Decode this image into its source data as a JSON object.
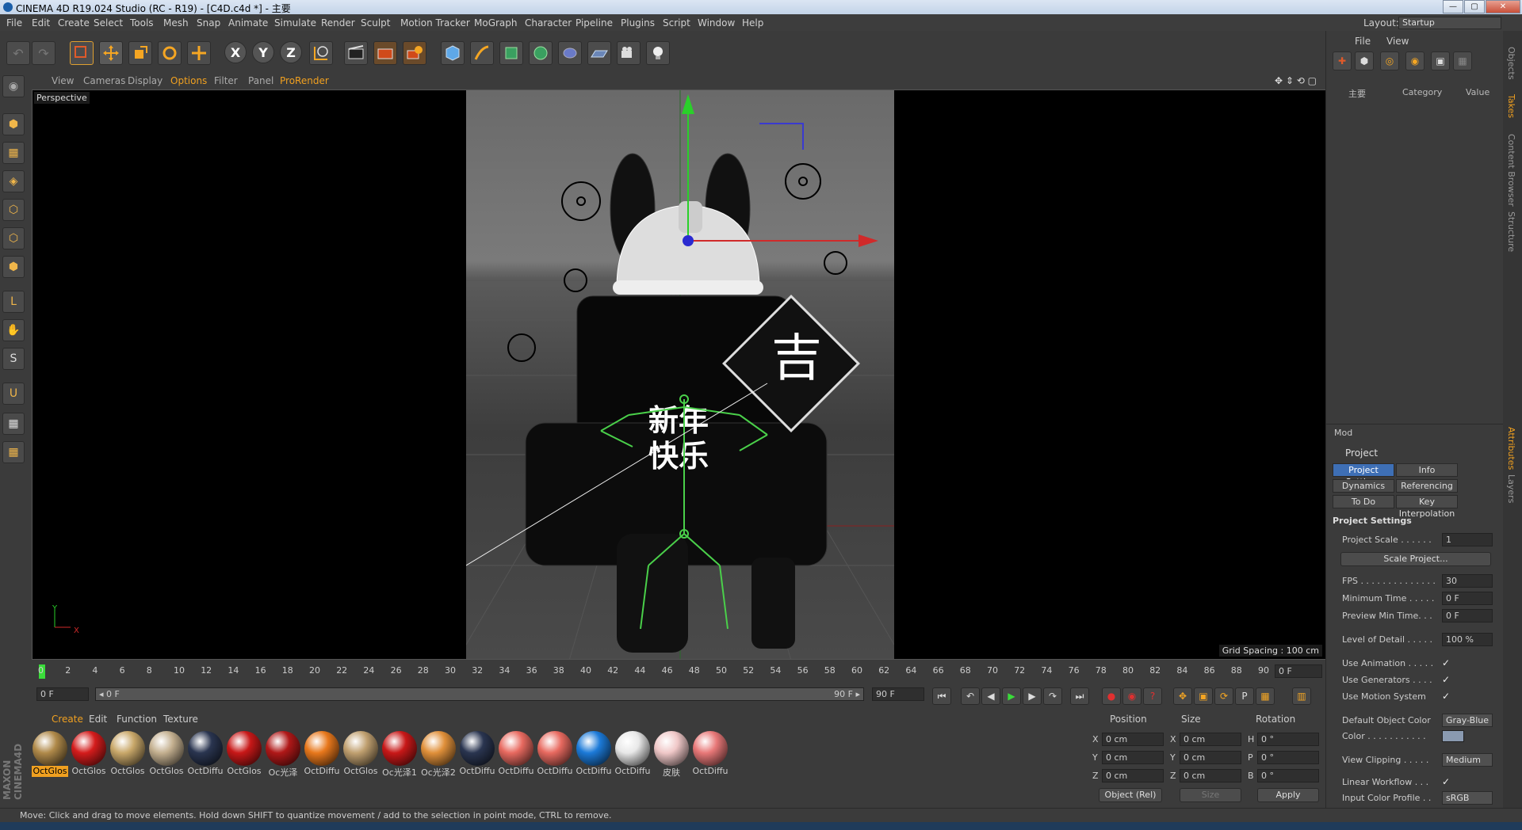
{
  "window": {
    "title": "CINEMA 4D R19.024 Studio (RC - R19) - [C4D.c4d *] - 主要",
    "min": "—",
    "max": "▢",
    "close": "✕"
  },
  "menu": [
    "File",
    "Edit",
    "Create",
    "Select",
    "Tools",
    "Mesh",
    "Snap",
    "Animate",
    "Simulate",
    "Render",
    "Sculpt",
    "Motion Tracker",
    "MoGraph",
    "Character",
    "Pipeline",
    "Plugins",
    "Script",
    "Window",
    "Help"
  ],
  "layout": {
    "label": "Layout:",
    "value": "Startup"
  },
  "toolbar_icons": [
    "undo-icon",
    "redo-icon",
    "live-selection-icon",
    "move-icon",
    "scale-icon",
    "rotate-icon",
    "transform-icon",
    "x-axis-icon",
    "y-axis-icon",
    "z-axis-icon",
    "world-coordinates-icon",
    "render-view-icon",
    "render-picture-viewer-icon",
    "render-settings-icon",
    "cube-icon",
    "pen-icon",
    "subdivision-icon",
    "cloner-icon",
    "deformer-icon",
    "floor-icon",
    "camera-icon",
    "light-icon"
  ],
  "toolbar_xyz": [
    "X",
    "Y",
    "Z"
  ],
  "viewport_menu": [
    "View",
    "Cameras",
    "Display",
    "Options",
    "Filter",
    "Panel",
    "ProRender"
  ],
  "viewport": {
    "label": "Perspective",
    "grid_spacing": "Grid Spacing : 100 cm",
    "axis_y": "Y",
    "axis_x": "X",
    "text_ji": "吉",
    "text_newyear_1": "新年",
    "text_newyear_2": "快乐"
  },
  "timeline": {
    "ticks": [
      "0",
      "2",
      "4",
      "6",
      "8",
      "10",
      "12",
      "14",
      "16",
      "18",
      "20",
      "22",
      "24",
      "26",
      "28",
      "30",
      "32",
      "34",
      "36",
      "38",
      "40",
      "42",
      "44",
      "46",
      "48",
      "50",
      "52",
      "54",
      "56",
      "58",
      "60",
      "62",
      "64",
      "66",
      "68",
      "70",
      "72",
      "74",
      "76",
      "78",
      "80",
      "82",
      "84",
      "86",
      "88",
      "90"
    ],
    "current_frame": "0 F",
    "start": "0 F",
    "range_start": "◂ 0 F",
    "range_end": "90 F ▸",
    "end": "90 F"
  },
  "material_menu": [
    "Create",
    "Edit",
    "Function",
    "Texture"
  ],
  "materials": [
    {
      "name": "OctGlos",
      "color": "#b08a4a",
      "selected": true
    },
    {
      "name": "OctGlos",
      "color": "#d41c1c"
    },
    {
      "name": "OctGlos",
      "color": "#c9a86a"
    },
    {
      "name": "OctGlos",
      "color": "#c4b090"
    },
    {
      "name": "OctDiffu",
      "color": "#2a3550"
    },
    {
      "name": "OctGlos",
      "color": "#c81818"
    },
    {
      "name": "Oc光泽",
      "color": "#b01818"
    },
    {
      "name": "OctDiffu",
      "color": "#e8781c"
    },
    {
      "name": "OctGlos",
      "color": "#c0a070"
    },
    {
      "name": "Oc光泽1",
      "color": "#c81818"
    },
    {
      "name": "Oc光泽2",
      "color": "#e0903a"
    },
    {
      "name": "OctDiffu",
      "color": "#2a3550"
    },
    {
      "name": "OctDiffu",
      "color": "#e86a60"
    },
    {
      "name": "OctDiffu",
      "color": "#e86a60"
    },
    {
      "name": "OctDiffu",
      "color": "#1c7ad8"
    },
    {
      "name": "OctDiffu",
      "color": "#e8e8e8"
    },
    {
      "name": "皮肤",
      "color": "#f0c8c8"
    },
    {
      "name": "OctDiffu",
      "color": "#e87878"
    }
  ],
  "coordinates": {
    "headers": [
      "Position",
      "Size",
      "Rotation"
    ],
    "rows": [
      {
        "pl": "X",
        "pv": "0 cm",
        "sl": "X",
        "sv": "0 cm",
        "rl": "H",
        "rv": "0 °"
      },
      {
        "pl": "Y",
        "pv": "0 cm",
        "sl": "Y",
        "sv": "0 cm",
        "rl": "P",
        "rv": "0 °"
      },
      {
        "pl": "Z",
        "pv": "0 cm",
        "sl": "Z",
        "sv": "0 cm",
        "rl": "B",
        "rv": "0 °"
      }
    ],
    "mode": "Object (Rel)",
    "size_mode": "Size",
    "apply": "Apply"
  },
  "status": "Move: Click and drag to move elements. Hold down SHIFT to quantize movement / add to the selection in point mode, CTRL to remove.",
  "objects": {
    "menu": [
      "File",
      "View"
    ],
    "item": "主要",
    "col_category": "Category",
    "col_value": "Value"
  },
  "side_tabs_top": [
    "Objects",
    "Takes",
    "Content Browser",
    "Structure"
  ],
  "side_tabs_bottom": [
    "Attributes",
    "Layers"
  ],
  "attributes": {
    "mode": "Mod",
    "title": "Project",
    "tabs": [
      "Project Settings",
      "Info",
      "Dynamics",
      "Referencing",
      "To Do",
      "Key Interpolation"
    ],
    "section": "Project Settings",
    "rows": [
      {
        "label": "Project Scale . . . . . .",
        "value": "1"
      },
      {
        "label": "FPS . . . . . . . . . . . . . .",
        "value": "30"
      },
      {
        "label": "Minimum Time . . . . .",
        "value": "0 F"
      },
      {
        "label": "Preview Min Time. . .",
        "value": "0 F"
      },
      {
        "label": "Level of Detail . . . . .",
        "value": "100 %"
      },
      {
        "label": "Use Animation . . . . .",
        "check": "✓"
      },
      {
        "label": "Use Generators . . . .",
        "check": "✓"
      },
      {
        "label": "Use Motion System",
        "check": "✓"
      },
      {
        "label": "Default Object Color",
        "button": "Gray-Blue"
      },
      {
        "label": "Color . . . . . . . . . . .",
        "swatch": "#8a9ab0"
      },
      {
        "label": "View Clipping . . . . .",
        "button": "Medium"
      },
      {
        "label": "Linear Workflow . . .",
        "check": "✓"
      },
      {
        "label": "Input Color Profile . .",
        "button": "sRGB"
      }
    ],
    "scale_button": "Scale Project..."
  }
}
